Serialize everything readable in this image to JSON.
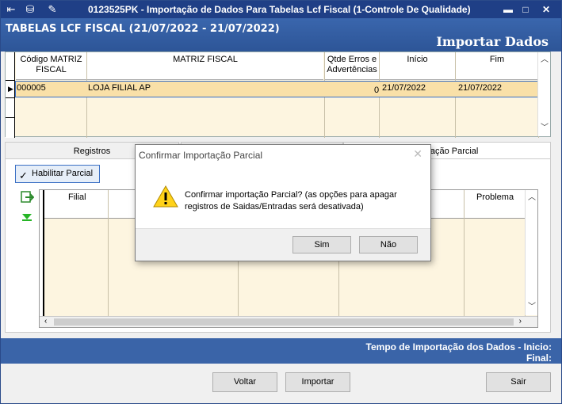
{
  "window": {
    "title": "0123525PK - Importação de Dados Para Tabelas Lcf Fiscal (1-Controle De Qualidade)"
  },
  "header": {
    "title": "TABELAS LCF FISCAL (21/07/2022 - 21/07/2022)",
    "action": "Importar Dados"
  },
  "top_grid": {
    "columns": [
      "Código MATRIZ FISCAL",
      "MATRIZ FISCAL",
      "Qtde Erros e Advertências",
      "Início",
      "Fim"
    ],
    "rows": [
      {
        "codigo": "000005",
        "matriz": "LOJA FILIAL AP",
        "qtde": "0",
        "inicio": "21/07/2022",
        "fim": "21/07/2022"
      }
    ]
  },
  "tabs": {
    "registros": "Registros",
    "importacao_parcial": "ortação Parcial"
  },
  "habilitar_parcial": "Habilitar Parcial",
  "detail_grid": {
    "columns": {
      "filial": "Filial",
      "problema": "Problema"
    }
  },
  "dialog": {
    "title": "Confirmar Importação Parcial",
    "message": "Confirmar importação Parcial? (as opções para apagar registros de Saidas/Entradas será desativada)",
    "yes_label": "Sim",
    "no_label": "Não"
  },
  "status": {
    "line1": "Tempo de Importação dos Dados - Inicio:",
    "line2": "Final:"
  },
  "buttons": {
    "voltar": "Voltar",
    "importar": "Importar",
    "sair": "Sair"
  },
  "colors": {
    "titlebar": "#1f3f86",
    "header": "#2f5aa0",
    "grid_bg": "#fdf5e0",
    "selected_row": "#f9e0a8"
  }
}
